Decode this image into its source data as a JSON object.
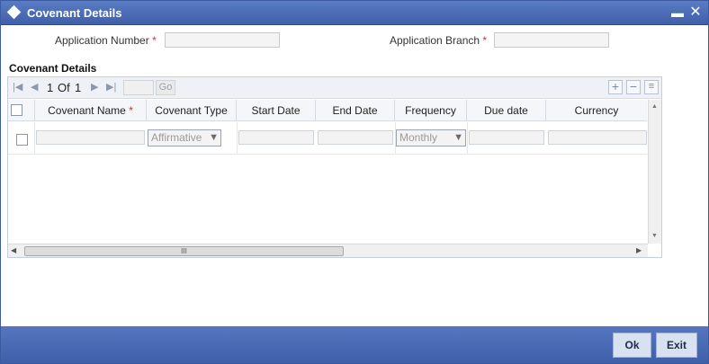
{
  "window": {
    "title": "Covenant Details",
    "minimize_icon": "minimize-icon",
    "close_icon": "close-icon"
  },
  "header": {
    "application_number_label": "Application Number",
    "application_branch_label": "Application Branch",
    "required_marker": "*",
    "application_number_value": "",
    "application_branch_value": ""
  },
  "section": {
    "title": "Covenant Details"
  },
  "pager": {
    "current": "1",
    "of_label": "Of",
    "total": "1",
    "page_input_value": "",
    "go_label": "Go"
  },
  "grid": {
    "columns": [
      "Covenant Name",
      "Covenant Type",
      "Start Date",
      "End Date",
      "Frequency",
      "Due date",
      "Currency"
    ],
    "rows": [
      {
        "covenant_name": "",
        "covenant_type": "Affirmative",
        "start_date": "",
        "end_date": "",
        "frequency": "Monthly",
        "due_date": "",
        "currency": ""
      }
    ]
  },
  "scrollbar": {
    "thumb_grip": "III"
  },
  "footer": {
    "ok_label": "Ok",
    "exit_label": "Exit"
  },
  "colors": {
    "titlebar": "#4a6bb3",
    "button_face": "#d7e1f0",
    "required": "#c0392b"
  }
}
